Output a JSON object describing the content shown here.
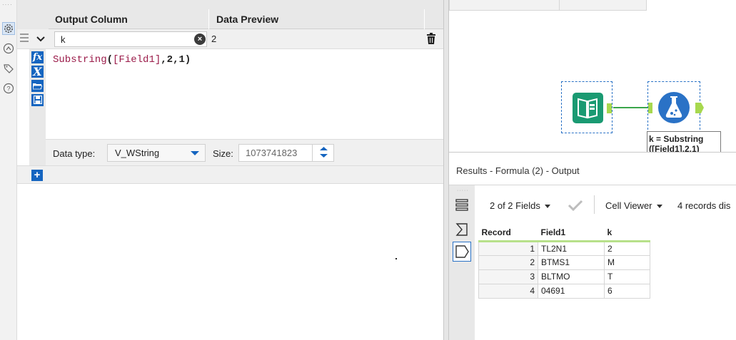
{
  "config": {
    "columns": {
      "output": "Output Column",
      "preview": "Data Preview"
    },
    "rows": [
      {
        "output_column": "k",
        "preview": "2",
        "expression": {
          "func": "Substring",
          "open": "(",
          "field": "[Field1]",
          "comma1": ",",
          "arg1": "2",
          "comma2": ",",
          "arg2": "1",
          "close": ")"
        },
        "data_type_label": "Data type:",
        "data_type": "V_WString",
        "size_label": "Size:",
        "size": "1073741823"
      }
    ],
    "add_button": "+"
  },
  "canvas": {
    "formula_label_line1": "k = Substring",
    "formula_label_line2": "([Field1],2,1)"
  },
  "results": {
    "title": "Results - Formula (2) - Output",
    "fields_selector": "2 of 2 Fields",
    "cell_viewer": "Cell Viewer",
    "records_text": "4 records dis",
    "table": {
      "headers": [
        "Record",
        "Field1",
        "k"
      ],
      "rows": [
        [
          "1",
          "TL2N1",
          "2"
        ],
        [
          "2",
          "BTMS1",
          "M"
        ],
        [
          "3",
          "BLTMO",
          "T"
        ],
        [
          "4",
          "04691",
          "6"
        ]
      ]
    }
  },
  "colors": {
    "accent": "#1565c0",
    "tool_green": "#1a9a72",
    "tool_blue": "#2a72c6",
    "connector": "#3aa64a",
    "anchor_green": "#a7d84e"
  }
}
